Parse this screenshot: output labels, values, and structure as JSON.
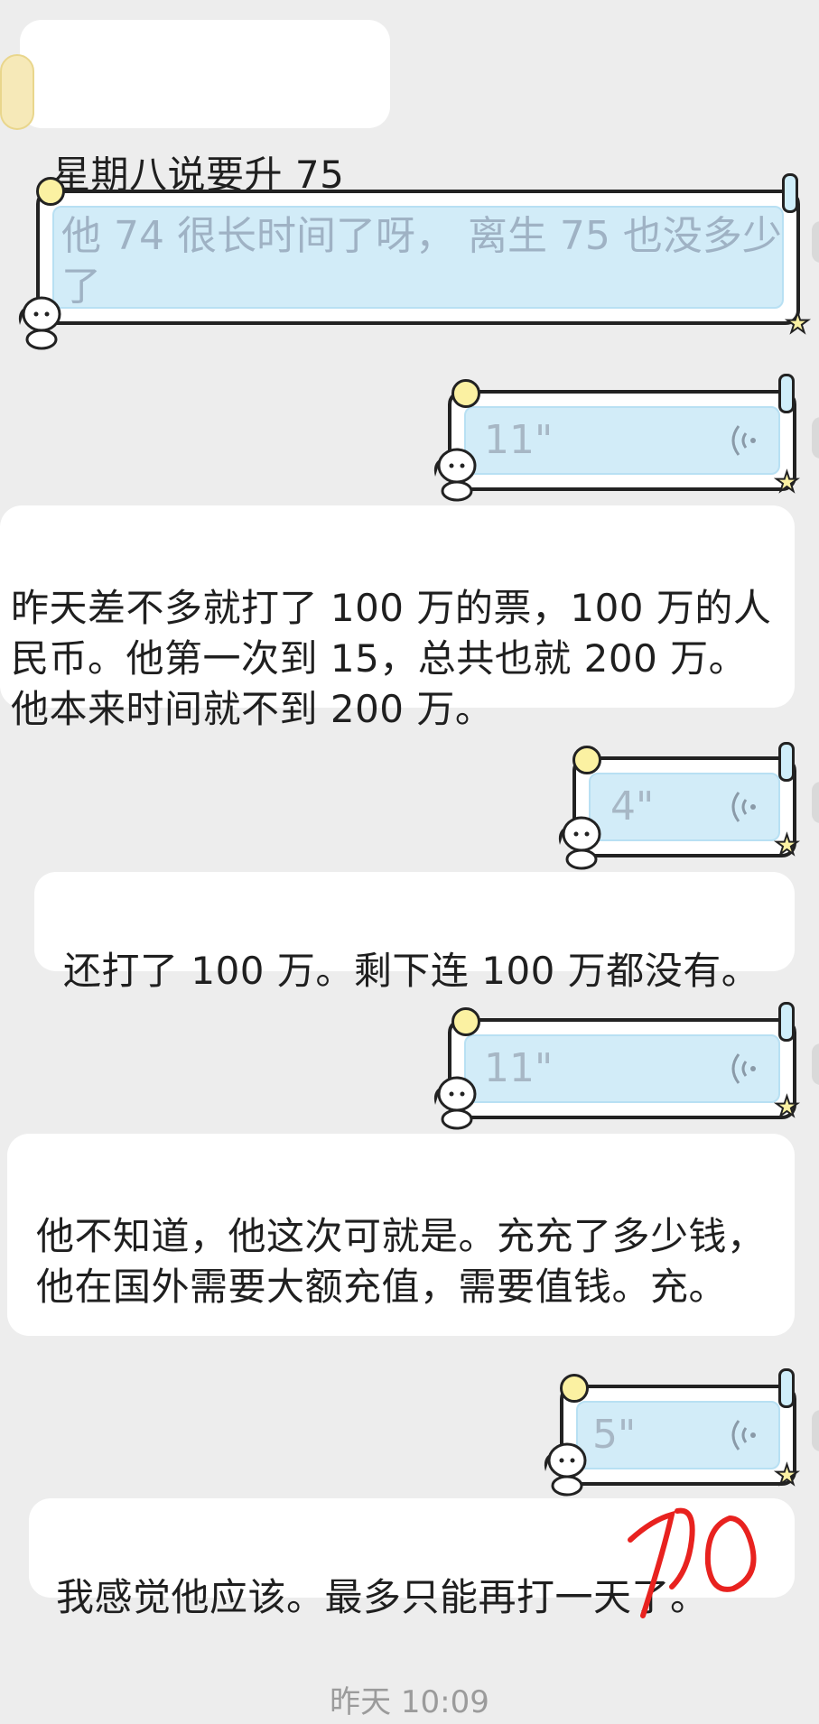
{
  "messages": {
    "m1": "星期八说要升 75",
    "m2": "他 74 很长时间了呀， 离生 75 也没多少了",
    "m3": "昨天差不多就打了 100 万的票，100 万的人民币。他第一次到 15，总共也就 200 万。他本来时间就不到 200 万。",
    "m4": "还打了 100 万。剩下连 100 万都没有。",
    "m5": "他不知道，他这次可就是。充充了多少钱，他在国外需要大额充值，需要值钱。充。",
    "m6": "我感觉他应该。最多只能再打一天了。"
  },
  "voice": {
    "v1": "11\"",
    "v2": "4\"",
    "v3": "11\"",
    "v4": "5\""
  },
  "handwriting": "10",
  "timestamp": "昨天 10:09",
  "colors": {
    "background": "#ededed",
    "bubble": "#ffffff",
    "frame_fill": "#d2ecf8",
    "handwriting": "#e8221f"
  }
}
